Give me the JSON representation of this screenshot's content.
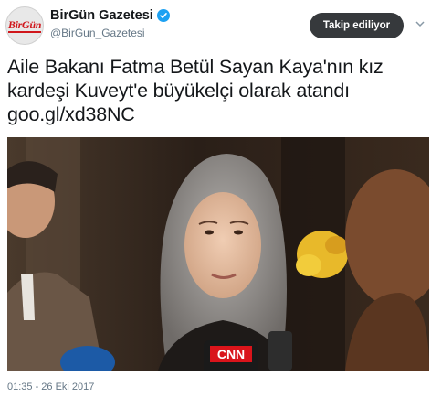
{
  "account": {
    "avatar_logo_text": "BirGün",
    "display_name": "BirGün Gazetesi",
    "handle": "@BirGun_Gazetesi",
    "verified_icon": "verified-badge-icon"
  },
  "follow_button": {
    "label": "Takip ediliyor"
  },
  "tweet": {
    "text_line1": "Aile Bakanı Fatma Betül Sayan Kaya'nın kız",
    "text_line2": "kardeşi Kuveyt'e büyükelçi olarak atandı",
    "link": "goo.gl/xd38NC",
    "timestamp": "01:35 - 26 Eki 2017"
  },
  "photo": {
    "microphone_logo": "CNN",
    "icons": [
      "cnn-microphone",
      "chevron-down-icon"
    ]
  },
  "colors": {
    "accent": "#1da1f2",
    "button_bg": "#36393c",
    "secondary_text": "#657786",
    "brand_red": "#d0161b"
  }
}
